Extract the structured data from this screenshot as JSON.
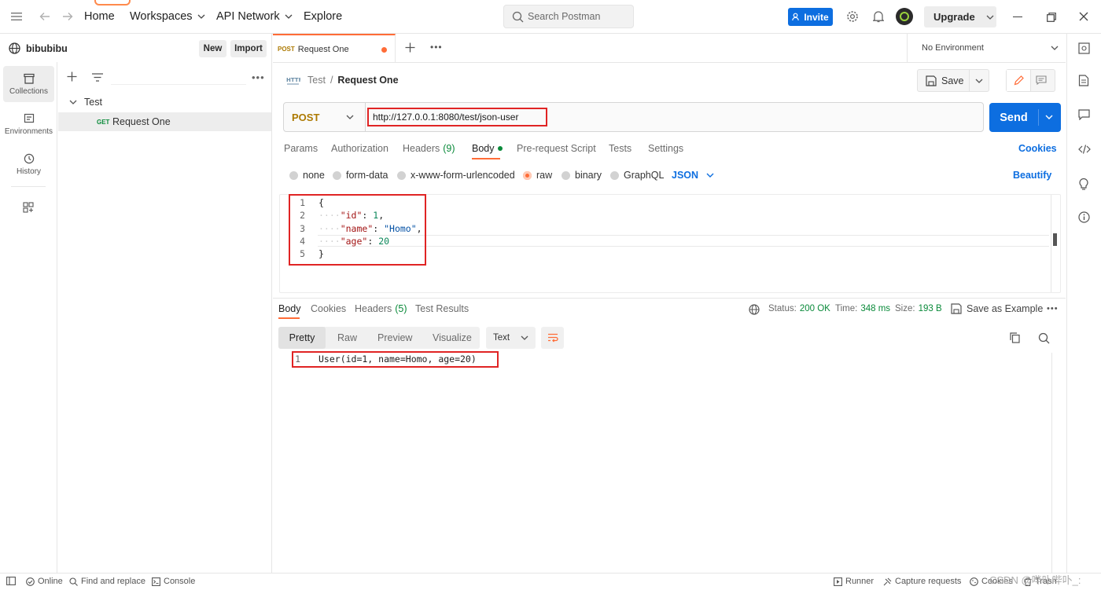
{
  "topbar": {
    "nav": {
      "home": "Home",
      "workspaces": "Workspaces",
      "api_network": "API Network",
      "explore": "Explore"
    },
    "search_placeholder": "Search Postman",
    "invite_label": "Invite",
    "upgrade_label": "Upgrade"
  },
  "sidebar": {
    "workspace_name": "bibubibu",
    "new_label": "New",
    "import_label": "Import",
    "rail": [
      {
        "label": "Collections"
      },
      {
        "label": "Environments"
      },
      {
        "label": "History"
      }
    ],
    "tree": {
      "collection": "Test",
      "request_method": "GET",
      "request_name": "Request One"
    }
  },
  "tabs": {
    "active_method": "POST",
    "active_name": "Request One"
  },
  "environment": {
    "selected": "No Environment"
  },
  "breadcrumb": {
    "collection": "Test",
    "separator": "/",
    "request": "Request One"
  },
  "toolbar": {
    "save_label": "Save"
  },
  "request": {
    "method": "POST",
    "url": "http://127.0.0.1:8080/test/json-user",
    "send_label": "Send",
    "tabs": [
      "Params",
      "Authorization",
      "Headers",
      "Body",
      "Pre-request Script",
      "Tests",
      "Settings"
    ],
    "headers_count": "(9)",
    "cookies_label": "Cookies",
    "body_types": [
      "none",
      "form-data",
      "x-www-form-urlencoded",
      "raw",
      "binary",
      "GraphQL"
    ],
    "raw_format": "JSON",
    "beautify_label": "Beautify",
    "line_numbers": [
      "1",
      "2",
      "3",
      "4",
      "5"
    ],
    "code": {
      "open": "{",
      "id_key": "\"id\"",
      "id_val": "1",
      "name_key": "\"name\"",
      "name_val": "\"Homo\"",
      "age_key": "\"age\"",
      "age_val": "20",
      "close": "}"
    }
  },
  "response": {
    "tabs": [
      "Body",
      "Cookies",
      "Headers",
      "Test Results"
    ],
    "headers_count": "(5)",
    "status_label": "Status:",
    "status_value": "200 OK",
    "time_label": "Time:",
    "time_value": "348 ms",
    "size_label": "Size:",
    "size_value": "193 B",
    "save_example_label": "Save as Example",
    "format_tabs": [
      "Pretty",
      "Raw",
      "Preview",
      "Visualize"
    ],
    "format_type": "Text",
    "line_number": "1",
    "body_text": "User(id=1, name=Homo, age=20)"
  },
  "statusbar": {
    "online": "Online",
    "find_replace": "Find and replace",
    "console": "Console",
    "runner": "Runner",
    "capture": "Capture requests",
    "cookies": "Cookies",
    "trash": "Trash",
    "watermark": "CSDN @哔卟哔卟_:"
  },
  "colors": {
    "accent": "#ff6c37",
    "primary": "#0d6ee0",
    "success": "#0a8a3a",
    "highlight": "#e02424"
  }
}
